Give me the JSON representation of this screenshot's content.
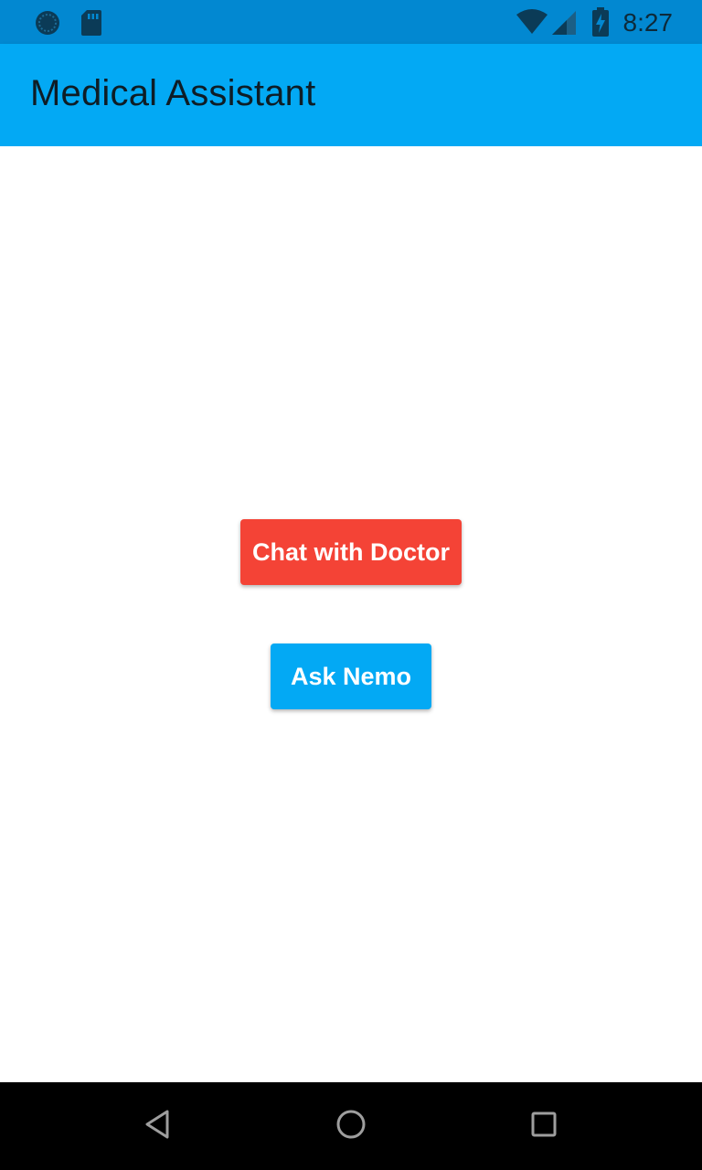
{
  "status_bar": {
    "time": "8:27",
    "icons": [
      "sync-icon",
      "sd-card-icon",
      "wifi-icon",
      "signal-icon",
      "battery-charging-icon"
    ],
    "background": "#0288d1"
  },
  "app_bar": {
    "title": "Medical Assistant",
    "background": "#03a9f4"
  },
  "main": {
    "chat_button_label": "Chat with Doctor",
    "chat_button_color": "#f44336",
    "ask_button_label": "Ask Nemo",
    "ask_button_color": "#03a9f4"
  },
  "nav_bar": {
    "icons": [
      "back-icon",
      "home-icon",
      "recents-icon"
    ]
  }
}
